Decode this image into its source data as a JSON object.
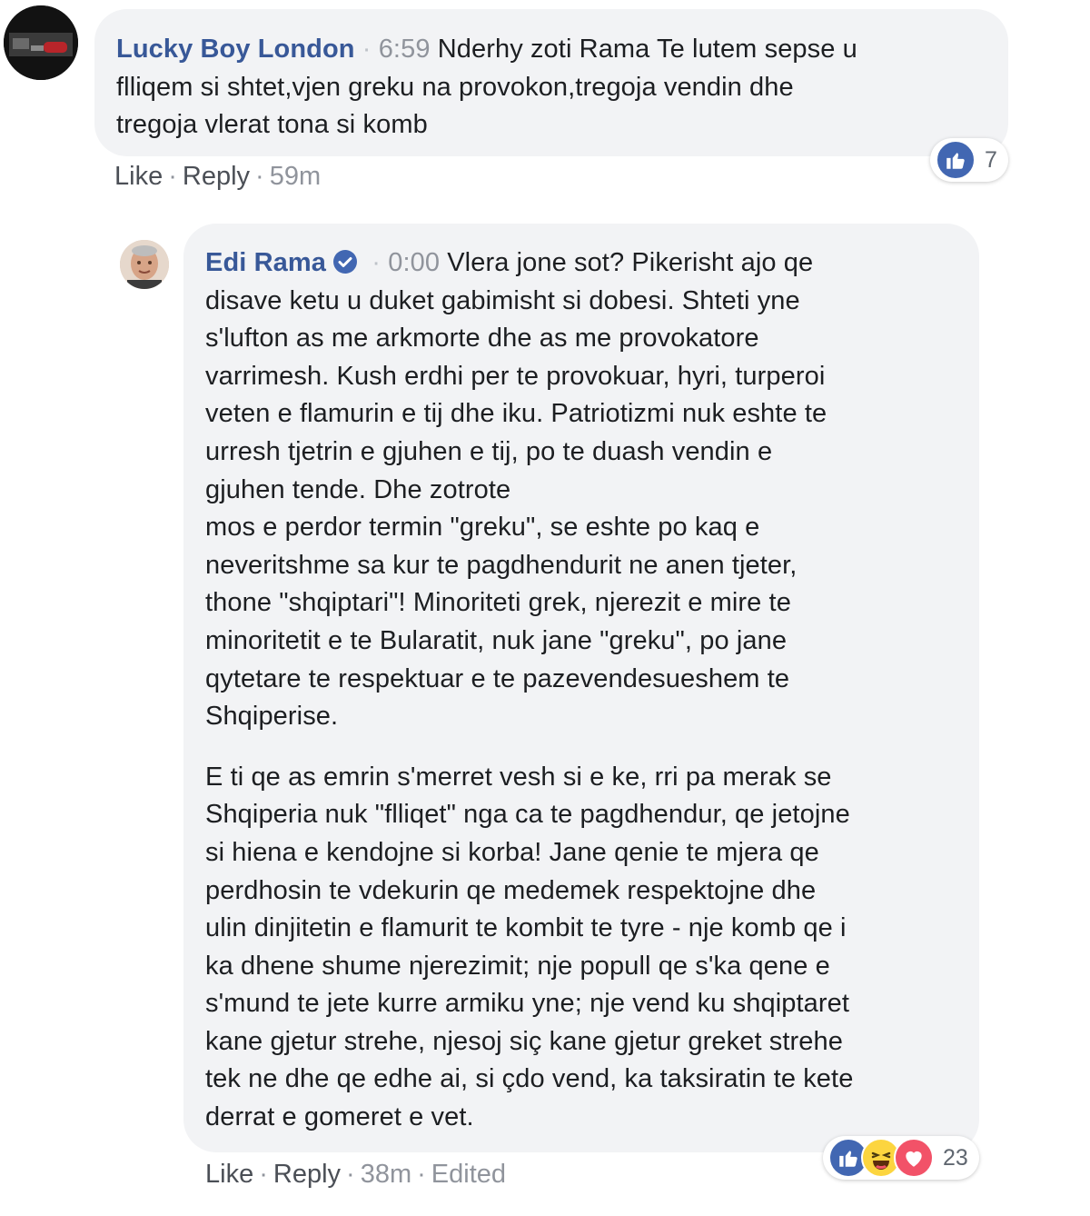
{
  "comment1": {
    "author": "Lucky Boy London",
    "media_time": "6:59",
    "text": "Nderhy zoti Rama Te lutem sepse u\nflliqem si shtet,vjen greku na provokon,tregoja vendin dhe\ntregoja vlerat tona si komb",
    "actions": {
      "like": "Like",
      "reply": "Reply",
      "age": "59m"
    },
    "reaction_count": "7",
    "reaction_icons": [
      "like-icon"
    ]
  },
  "comment2": {
    "author": "Edi Rama",
    "verified": true,
    "media_time": "0:00",
    "paragraph1": "Vlera jone sot? Pikerisht ajo qe\ndisave ketu u duket gabimisht si dobesi. Shteti yne\ns'lufton as me arkmorte dhe as me provokatore\nvarrimesh. Kush erdhi per te provokuar, hyri, turperoi\nveten e flamurin e tij dhe iku. Patriotizmi nuk eshte te\nurresh tjetrin e gjuhen e tij, po te duash vendin e\ngjuhen tende. Dhe zotrote\nmos e perdor termin \"greku\", se eshte po kaq e\nneveritshme sa kur te pagdhendurit ne anen tjeter,\nthone \"shqiptari\"! Minoriteti grek, njerezit e mire te\nminoritetit e te Bularatit, nuk jane \"greku\", po jane\nqytetare te respektuar e te pazevendesueshem te\nShqiperise.",
    "paragraph2": "E ti qe as emrin s'merret vesh si e ke, rri pa merak se\nShqiperia nuk \"flliqet\" nga ca te pagdhendur, qe jetojne\nsi hiena e kendojne si korba! Jane qenie te mjera qe\nperdhosin te vdekurin qe medemek respektojne dhe\nulin dinjitetin e flamurit te kombit te tyre - nje komb qe i\nka dhene shume njerezimit; nje popull qe s'ka qene e\ns'mund te jete kurre armiku yne; nje vend ku shqiptaret\nkane gjetur strehe, njesoj siç kane gjetur greket strehe\ntek ne dhe qe edhe ai, si çdo vend, ka taksiratin te kete\nderrat e gomeret e vet.",
    "actions": {
      "like": "Like",
      "reply": "Reply",
      "age": "38m",
      "edited": "Edited"
    },
    "reaction_count": "23",
    "reaction_icons": [
      "like-icon",
      "haha-icon",
      "love-icon"
    ]
  },
  "colors": {
    "name": "#385898",
    "bubble": "#f2f3f5",
    "meta": "#90949c",
    "like_blue": "#4267b2",
    "love_red": "#f25268",
    "haha_yellow": "#fcd53f"
  }
}
